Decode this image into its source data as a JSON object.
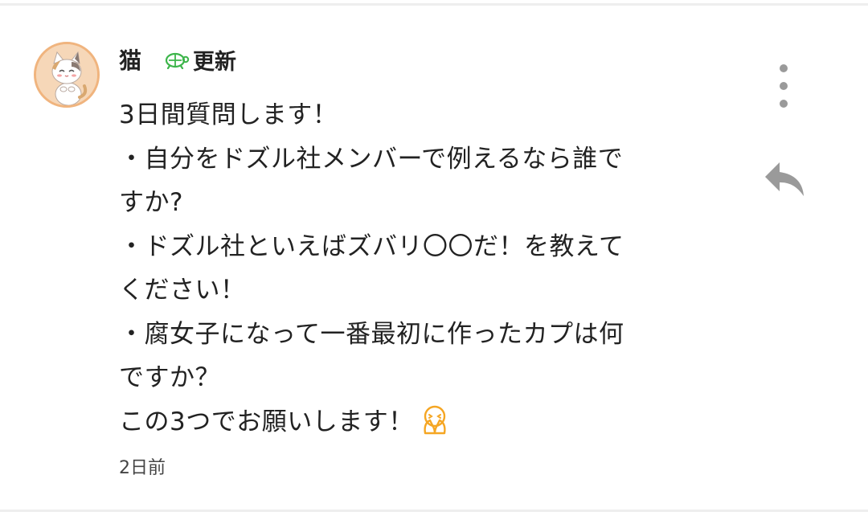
{
  "comment": {
    "author": "猫",
    "badge_label": "更新",
    "body_lines": [
      "3日間質問します！",
      "・自分をドズル社メンバーで例えるなら誰で",
      "すか?",
      "・ドズル社といえばズバリ〇〇だ！を教えて",
      "ください！",
      "・腐女子になって一番最初に作ったカプは何",
      "ですか？",
      "この3つでお願いします！"
    ],
    "timestamp": "2日前",
    "icons": {
      "avatar": "cat-avatar",
      "badge": "turtle-icon",
      "emoji": "pleading-hands-emoji-icon",
      "more": "more-vertical-icon",
      "reply": "reply-icon"
    },
    "colors": {
      "badge_icon": "#3cb54a",
      "emoji": "#f5a623",
      "icon_gray": "#9a9a9a"
    }
  }
}
